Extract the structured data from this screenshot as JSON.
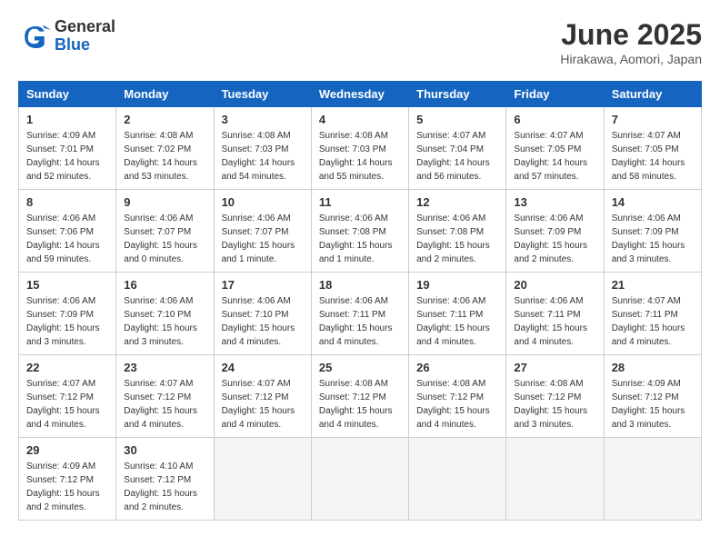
{
  "header": {
    "logo_general": "General",
    "logo_blue": "Blue",
    "month_title": "June 2025",
    "subtitle": "Hirakawa, Aomori, Japan"
  },
  "days_of_week": [
    "Sunday",
    "Monday",
    "Tuesday",
    "Wednesday",
    "Thursday",
    "Friday",
    "Saturday"
  ],
  "weeks": [
    [
      {
        "day": "1",
        "sunrise": "4:09 AM",
        "sunset": "7:01 PM",
        "daylight": "14 hours and 52 minutes."
      },
      {
        "day": "2",
        "sunrise": "4:08 AM",
        "sunset": "7:02 PM",
        "daylight": "14 hours and 53 minutes."
      },
      {
        "day": "3",
        "sunrise": "4:08 AM",
        "sunset": "7:03 PM",
        "daylight": "14 hours and 54 minutes."
      },
      {
        "day": "4",
        "sunrise": "4:08 AM",
        "sunset": "7:03 PM",
        "daylight": "14 hours and 55 minutes."
      },
      {
        "day": "5",
        "sunrise": "4:07 AM",
        "sunset": "7:04 PM",
        "daylight": "14 hours and 56 minutes."
      },
      {
        "day": "6",
        "sunrise": "4:07 AM",
        "sunset": "7:05 PM",
        "daylight": "14 hours and 57 minutes."
      },
      {
        "day": "7",
        "sunrise": "4:07 AM",
        "sunset": "7:05 PM",
        "daylight": "14 hours and 58 minutes."
      }
    ],
    [
      {
        "day": "8",
        "sunrise": "4:06 AM",
        "sunset": "7:06 PM",
        "daylight": "14 hours and 59 minutes."
      },
      {
        "day": "9",
        "sunrise": "4:06 AM",
        "sunset": "7:07 PM",
        "daylight": "15 hours and 0 minutes."
      },
      {
        "day": "10",
        "sunrise": "4:06 AM",
        "sunset": "7:07 PM",
        "daylight": "15 hours and 1 minute."
      },
      {
        "day": "11",
        "sunrise": "4:06 AM",
        "sunset": "7:08 PM",
        "daylight": "15 hours and 1 minute."
      },
      {
        "day": "12",
        "sunrise": "4:06 AM",
        "sunset": "7:08 PM",
        "daylight": "15 hours and 2 minutes."
      },
      {
        "day": "13",
        "sunrise": "4:06 AM",
        "sunset": "7:09 PM",
        "daylight": "15 hours and 2 minutes."
      },
      {
        "day": "14",
        "sunrise": "4:06 AM",
        "sunset": "7:09 PM",
        "daylight": "15 hours and 3 minutes."
      }
    ],
    [
      {
        "day": "15",
        "sunrise": "4:06 AM",
        "sunset": "7:09 PM",
        "daylight": "15 hours and 3 minutes."
      },
      {
        "day": "16",
        "sunrise": "4:06 AM",
        "sunset": "7:10 PM",
        "daylight": "15 hours and 3 minutes."
      },
      {
        "day": "17",
        "sunrise": "4:06 AM",
        "sunset": "7:10 PM",
        "daylight": "15 hours and 4 minutes."
      },
      {
        "day": "18",
        "sunrise": "4:06 AM",
        "sunset": "7:11 PM",
        "daylight": "15 hours and 4 minutes."
      },
      {
        "day": "19",
        "sunrise": "4:06 AM",
        "sunset": "7:11 PM",
        "daylight": "15 hours and 4 minutes."
      },
      {
        "day": "20",
        "sunrise": "4:06 AM",
        "sunset": "7:11 PM",
        "daylight": "15 hours and 4 minutes."
      },
      {
        "day": "21",
        "sunrise": "4:07 AM",
        "sunset": "7:11 PM",
        "daylight": "15 hours and 4 minutes."
      }
    ],
    [
      {
        "day": "22",
        "sunrise": "4:07 AM",
        "sunset": "7:12 PM",
        "daylight": "15 hours and 4 minutes."
      },
      {
        "day": "23",
        "sunrise": "4:07 AM",
        "sunset": "7:12 PM",
        "daylight": "15 hours and 4 minutes."
      },
      {
        "day": "24",
        "sunrise": "4:07 AM",
        "sunset": "7:12 PM",
        "daylight": "15 hours and 4 minutes."
      },
      {
        "day": "25",
        "sunrise": "4:08 AM",
        "sunset": "7:12 PM",
        "daylight": "15 hours and 4 minutes."
      },
      {
        "day": "26",
        "sunrise": "4:08 AM",
        "sunset": "7:12 PM",
        "daylight": "15 hours and 4 minutes."
      },
      {
        "day": "27",
        "sunrise": "4:08 AM",
        "sunset": "7:12 PM",
        "daylight": "15 hours and 3 minutes."
      },
      {
        "day": "28",
        "sunrise": "4:09 AM",
        "sunset": "7:12 PM",
        "daylight": "15 hours and 3 minutes."
      }
    ],
    [
      {
        "day": "29",
        "sunrise": "4:09 AM",
        "sunset": "7:12 PM",
        "daylight": "15 hours and 2 minutes."
      },
      {
        "day": "30",
        "sunrise": "4:10 AM",
        "sunset": "7:12 PM",
        "daylight": "15 hours and 2 minutes."
      },
      null,
      null,
      null,
      null,
      null
    ]
  ]
}
